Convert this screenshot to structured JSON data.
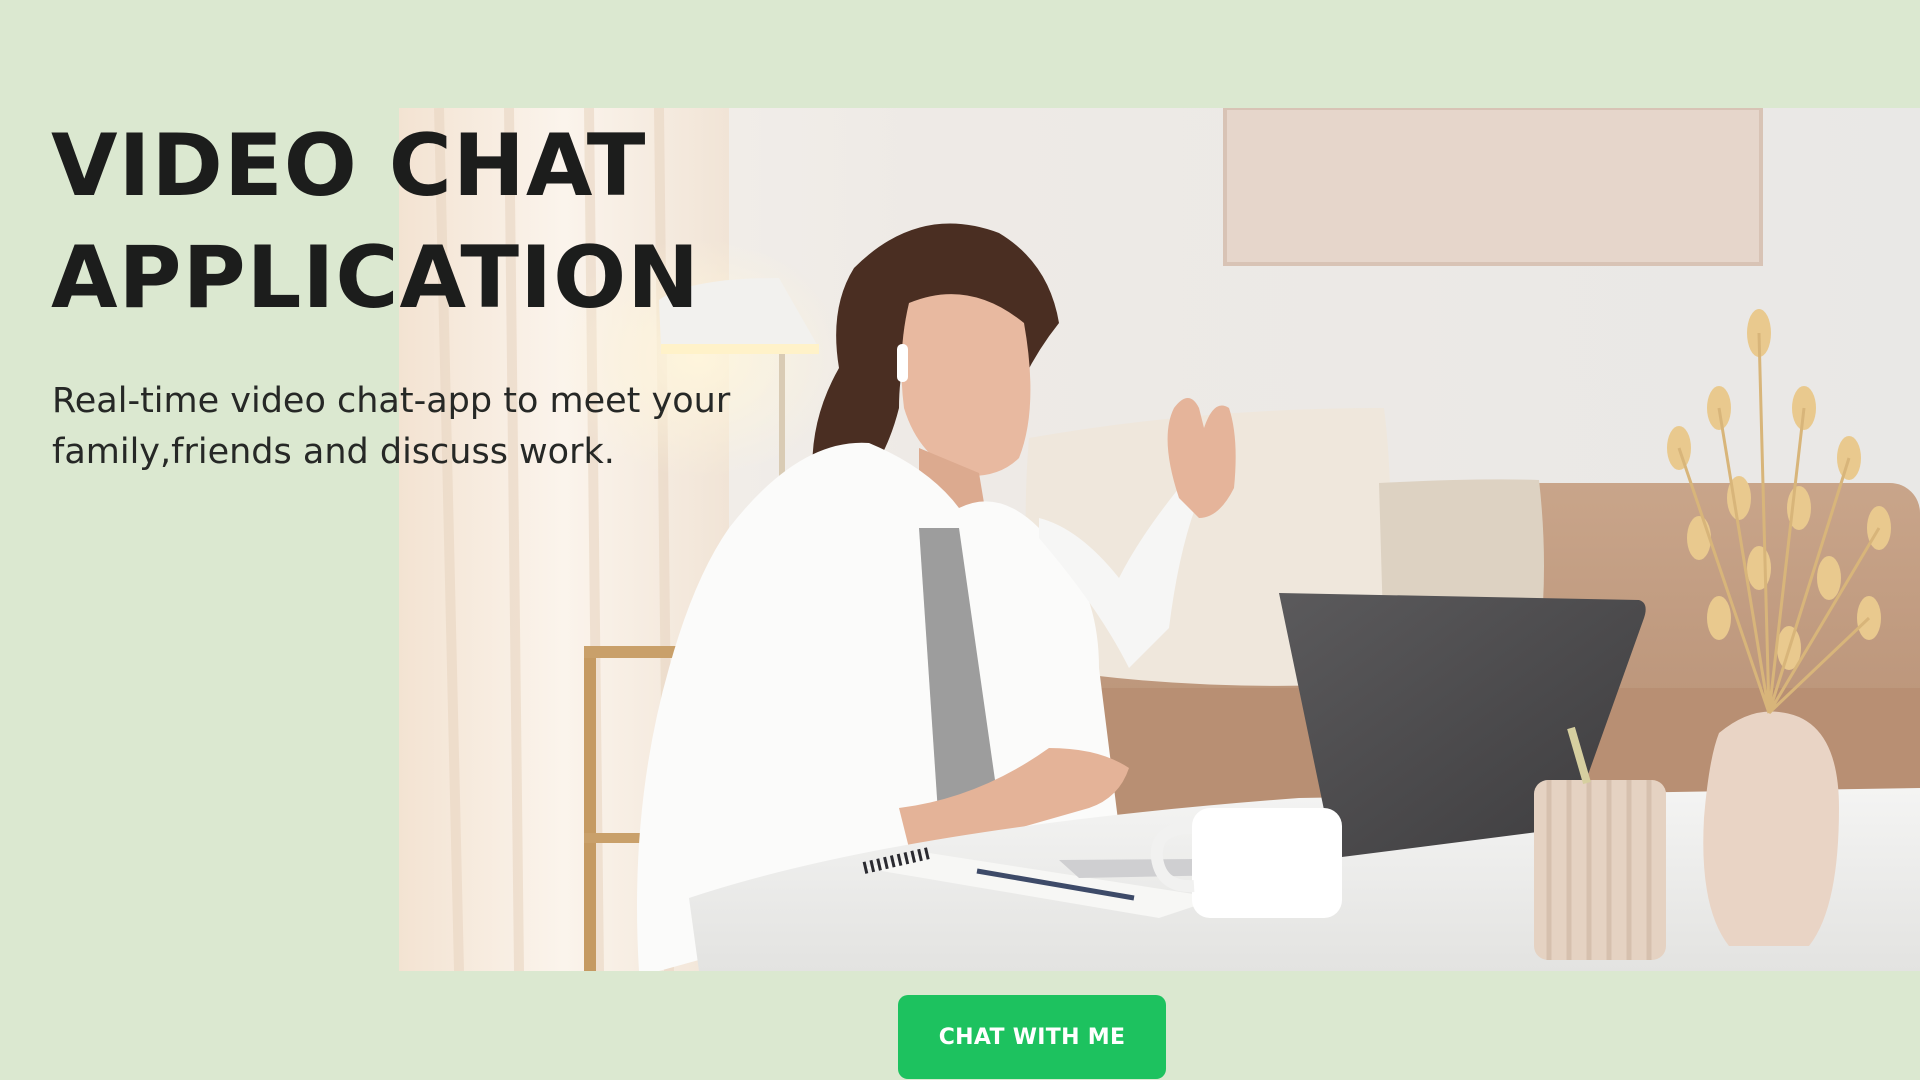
{
  "hero": {
    "title_line_1": "VIDEO CHAT",
    "title_line_2": "APPLICATION",
    "subtitle_line_1": "Real-time video chat-app to meet your",
    "subtitle_line_2": "family,friends and discuss work.",
    "cta_label": "CHAT WITH ME",
    "image_icon": "woman-video-call-photo"
  },
  "colors": {
    "page_background": "#dbe8d0",
    "title_text": "#1c1d1c",
    "body_text": "#262826",
    "cta_background": "#1dc25f",
    "cta_text": "#ffffff"
  }
}
